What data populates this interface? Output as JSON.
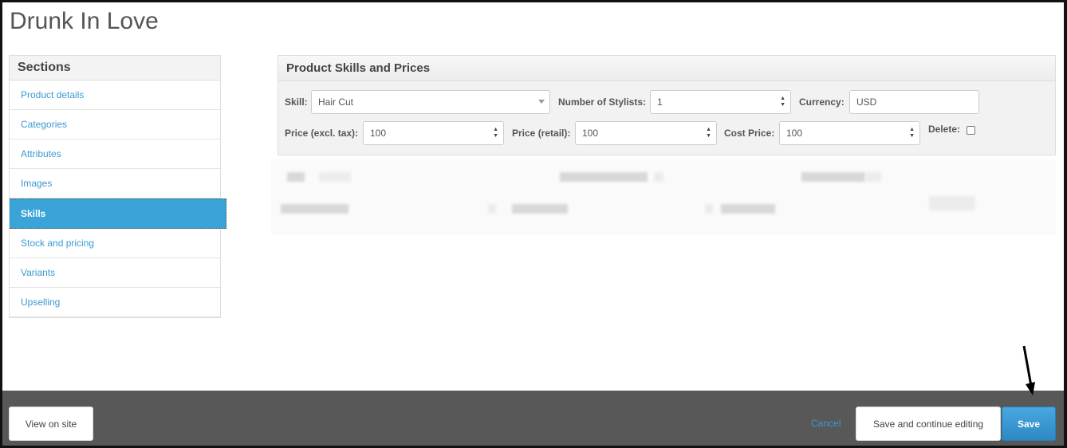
{
  "page": {
    "title": "Drunk In Love"
  },
  "sections": {
    "header": "Sections",
    "items": [
      {
        "label": "Product details",
        "active": false
      },
      {
        "label": "Categories",
        "active": false
      },
      {
        "label": "Attributes",
        "active": false
      },
      {
        "label": "Images",
        "active": false
      },
      {
        "label": "Skills",
        "active": true
      },
      {
        "label": "Stock and pricing",
        "active": false
      },
      {
        "label": "Variants",
        "active": false
      },
      {
        "label": "Upselling",
        "active": false
      }
    ]
  },
  "skills_panel": {
    "title": "Product Skills and Prices",
    "skill": {
      "label": "Skill:",
      "value": "Hair Cut"
    },
    "stylists": {
      "label": "Number of Stylists:",
      "value": "1"
    },
    "currency": {
      "label": "Currency:",
      "value": "USD"
    },
    "price_excl": {
      "label": "Price (excl. tax):",
      "value": "100"
    },
    "price_retail": {
      "label": "Price (retail):",
      "value": "100"
    },
    "cost_price": {
      "label": "Cost Price:",
      "value": "100"
    },
    "delete": {
      "label": "Delete:",
      "checked": false
    }
  },
  "footer": {
    "view_on_site": "View on site",
    "cancel": "Cancel",
    "save_continue": "Save and continue editing",
    "save": "Save"
  },
  "colors": {
    "accent": "#3aa3d7",
    "link": "#3b99d2",
    "footer_bg": "#585858",
    "primary_button": "#2d88c4"
  }
}
